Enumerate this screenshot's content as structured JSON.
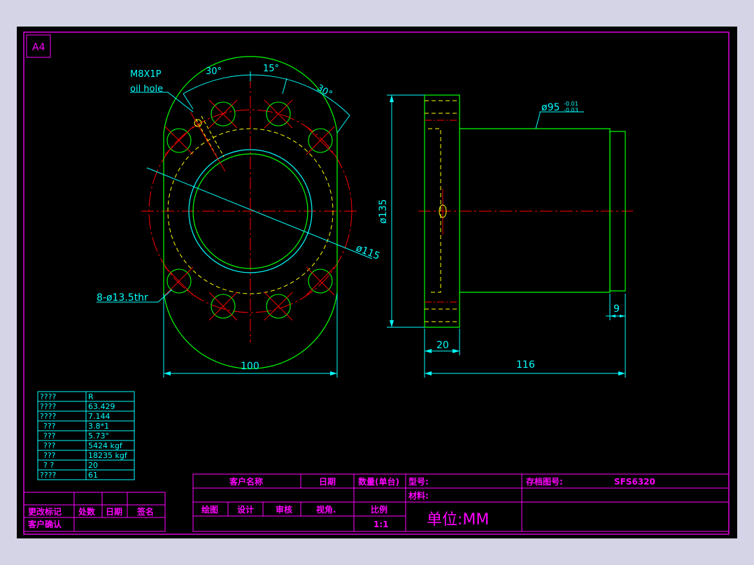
{
  "sheet": {
    "size_label": "A4"
  },
  "colors": {
    "background": "#000000",
    "border": "#ff00ff",
    "outline": "#00ff00",
    "dimension": "#00ffff",
    "centerline": "#ff0000",
    "hidden": "#ffff00",
    "page": "#d4d4e6"
  },
  "front_view": {
    "hole_note_line1": "M8X1P",
    "hole_note_line2": "oil hole",
    "angle_left": "30°",
    "angle_top": "15°",
    "angle_right": "30°",
    "pcd": "ø115",
    "bolt_holes": "8-ø13.5thr",
    "width": "100"
  },
  "side_view": {
    "shank_dia": "ø95",
    "tol_upper": "-0.01",
    "tol_lower": "-0.03",
    "flange_dia": "ø135",
    "flange_thickness": "20",
    "length": "116",
    "end_step": "9"
  },
  "param_table": {
    "rows": [
      [
        "????",
        "R"
      ],
      [
        "????",
        "63.429"
      ],
      [
        "????",
        "7.144"
      ],
      [
        "???",
        "3.8*1"
      ],
      [
        "???",
        "5.73°"
      ],
      [
        "???",
        "5424  kgf"
      ],
      [
        "???",
        "18235  kgf"
      ],
      [
        "?  ?",
        "20"
      ],
      [
        "????",
        "61"
      ]
    ]
  },
  "revision_block": {
    "change_mark": "更改标记",
    "count": "处数",
    "date": "日期",
    "sign": "签名",
    "customer_confirm": "客户确认"
  },
  "title_block": {
    "customer_name": "客户名称",
    "date": "日期",
    "quantity": "数量(单台)",
    "model": "型号:",
    "archive_no": "存档图号:",
    "drawing_no": "SFS6320",
    "material": "材料:",
    "drawn": "绘图",
    "design": "设计",
    "review": "审核",
    "view_angle": "视角.",
    "scale_label": "比例",
    "scale_value": "1:1",
    "unit": "单位:MM"
  }
}
